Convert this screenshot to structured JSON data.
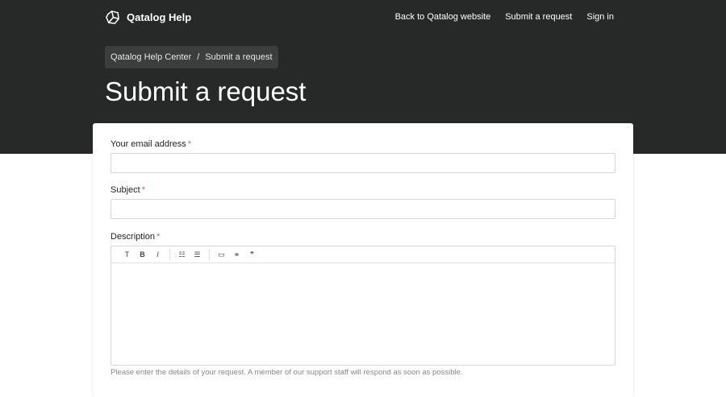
{
  "header": {
    "brand": "Qatalog Help",
    "nav": [
      "Back to Qatalog website",
      "Submit a request",
      "Sign in"
    ]
  },
  "breadcrumb": {
    "items": [
      "Qatalog Help Center",
      "Submit a request"
    ],
    "separator": "/"
  },
  "page_title": "Submit a request",
  "form": {
    "email_label": "Your email address",
    "subject_label": "Subject",
    "description_label": "Description",
    "required_mark": "*",
    "toolbar": [
      "T",
      "B",
      "I",
      "☷",
      "☰",
      "▭",
      "⚭",
      "❞"
    ],
    "description_hint": "Please enter the details of your request. A member of our support staff will respond as soon as possible."
  }
}
